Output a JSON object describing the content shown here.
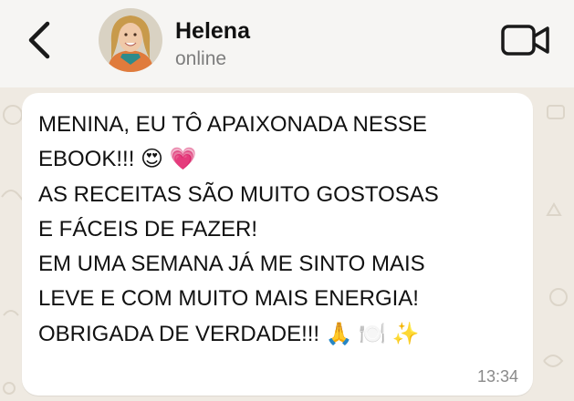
{
  "contact": {
    "name": "Helena",
    "status": "online"
  },
  "message": {
    "lines": [
      "MENINA, EU TÔ APAIXONADA NESSE",
      "EBOOK!!! 😍 💗",
      "AS RECEITAS SÃO MUITO GOSTOSAS",
      "E FÁCEIS DE FAZER!",
      "EM UMA SEMANA JÁ ME SINTO MAIS",
      "LEVE E COM MUITO MAIS ENERGIA!",
      "OBRIGADA DE VERDADE!!! 🙏 🍽️ ✨"
    ],
    "time": "13:34"
  },
  "icons": {
    "back": "chevron-left-icon",
    "video": "video-camera-icon"
  },
  "colors": {
    "header_bg": "#f6f5f3",
    "chat_bg": "#efeae2",
    "bubble_bg": "#ffffff"
  }
}
